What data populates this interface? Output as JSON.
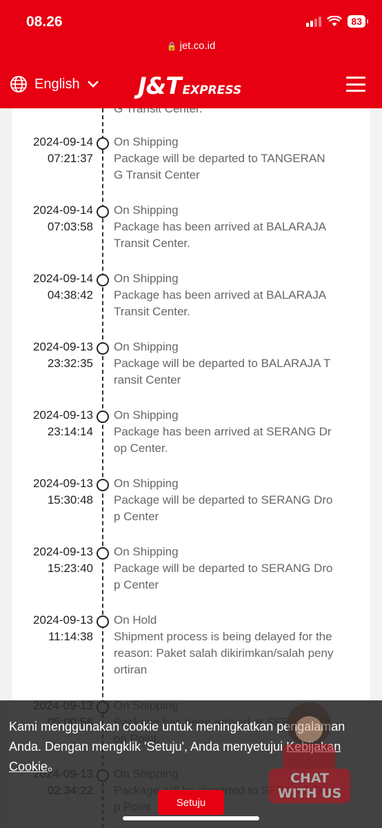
{
  "status_bar": {
    "time": "08.26",
    "battery": "83"
  },
  "browser": {
    "url": "jet.co.id"
  },
  "nav": {
    "language": "English",
    "logo_main": "J&T",
    "logo_sub": "EXPRESS"
  },
  "timeline": {
    "partial_top_text": "G Transit Center.",
    "entries": [
      {
        "date": "2024-09-14",
        "time": "07:21:37",
        "status": "On Shipping",
        "lines": [
          "Package will be departed to TANGERAN",
          "G Transit Center"
        ]
      },
      {
        "date": "2024-09-14",
        "time": "07:03:58",
        "status": "On Shipping",
        "lines": [
          "Package has been arrived at BALARAJA",
          "Transit Center."
        ]
      },
      {
        "date": "2024-09-14",
        "time": "04:38:42",
        "status": "On Shipping",
        "lines": [
          "Package has been arrived at BALARAJA",
          "Transit Center."
        ]
      },
      {
        "date": "2024-09-13",
        "time": "23:32:35",
        "status": "On Shipping",
        "lines": [
          "Package will be departed to BALARAJA T",
          "ransit Center"
        ]
      },
      {
        "date": "2024-09-13",
        "time": "23:14:14",
        "status": "On Shipping",
        "lines": [
          "Package has been arrived at SERANG Dr",
          "op Center."
        ]
      },
      {
        "date": "2024-09-13",
        "time": "15:30:48",
        "status": "On Shipping",
        "lines": [
          "Package will be departed to SERANG Dro",
          "p Center"
        ]
      },
      {
        "date": "2024-09-13",
        "time": "15:23:40",
        "status": "On Shipping",
        "lines": [
          "Package will be departed to SERANG Dro",
          "p Center"
        ]
      },
      {
        "date": "2024-09-13",
        "time": "11:14:38",
        "status": "On Hold",
        "lines": [
          "Shipment process is being delayed for the",
          "reason: Paket salah dikirimkan/salah peny",
          "ortiran"
        ]
      },
      {
        "date": "2024-09-13",
        "time": "05:00:58",
        "status": "On Shipping",
        "lines": [
          "Package has been arrived at SERANG Dr",
          "op Point."
        ]
      },
      {
        "date": "2024-09-13",
        "time": "02:34:22",
        "status": "On Shipping",
        "lines": [
          "Package will be departed to SERANG Dro",
          "p Point"
        ]
      }
    ]
  },
  "cookie": {
    "text_before": "Kami menggunakan cookie untuk meningkatkan pengalaman Anda. Dengan mengklik 'Setuju', Anda menyetujui ",
    "link": "Kebijakan Cookie",
    "text_after": "。",
    "button": "Setuju"
  },
  "chat_widget": {
    "line1": "CHAT",
    "line2": "WITH US"
  }
}
